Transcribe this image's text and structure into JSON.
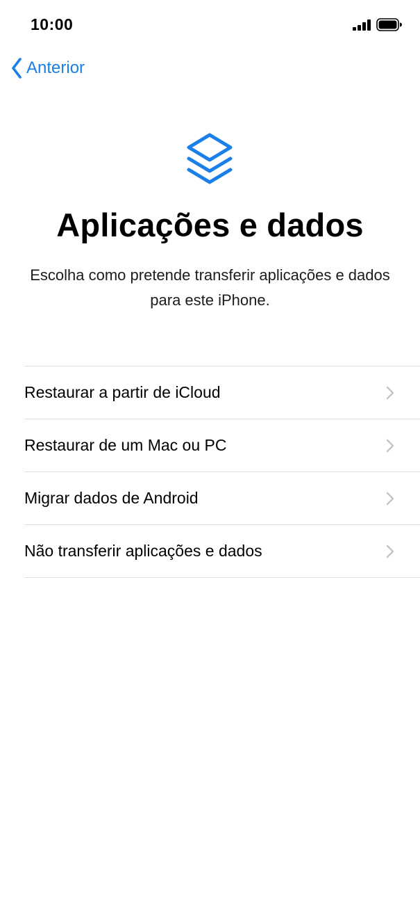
{
  "status_bar": {
    "time": "10:00"
  },
  "nav": {
    "back_label": "Anterior"
  },
  "icons": {
    "hero": "stacked-layers-icon",
    "back": "chevron-left-icon",
    "row_disclosure": "chevron-right-icon",
    "signal": "cellular-signal-icon",
    "battery": "battery-icon"
  },
  "colors": {
    "accent": "#1a7fe6",
    "separator": "#e1e1e4",
    "chevron": "#c4c4c7"
  },
  "header": {
    "title": "Aplicações e dados",
    "subtitle": "Escolha como pretende transferir aplicações e dados para este iPhone."
  },
  "options": [
    {
      "label": "Restaurar a partir de iCloud"
    },
    {
      "label": "Restaurar de um Mac ou PC"
    },
    {
      "label": "Migrar dados de Android"
    },
    {
      "label": "Não transferir aplicações e dados"
    }
  ]
}
